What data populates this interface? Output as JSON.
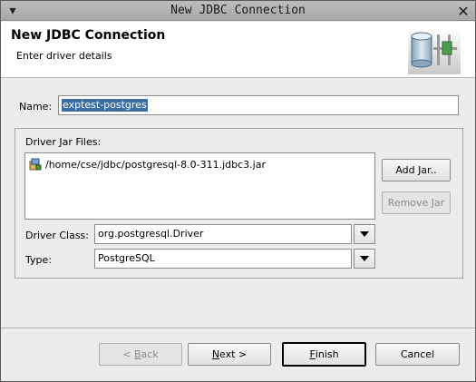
{
  "window": {
    "title": "New JDBC Connection"
  },
  "header": {
    "title": "New JDBC Connection",
    "subtitle": "Enter driver details",
    "icon": "database-connection-icon"
  },
  "name": {
    "label": "Name:",
    "value": "exptest-postgres"
  },
  "driver_jars": {
    "label": "Driver Jar Files:",
    "items": [
      {
        "path": "/home/cse/jdbc/postgresql-8.0-311.jdbc3.jar",
        "icon": "jar-file-icon"
      }
    ],
    "add_label": "Add Jar..",
    "remove_label": "Remove Jar"
  },
  "driver_class": {
    "label": "Driver Class:",
    "value": "org.postgresql.Driver"
  },
  "type": {
    "label": "Type:",
    "value": "PostgreSQL"
  },
  "buttons": {
    "back_prefix": "< ",
    "back_mnemonic": "B",
    "back_rest": "ack",
    "next_mnemonic": "N",
    "next_rest": "ext >",
    "finish_mnemonic": "F",
    "finish_rest": "inish",
    "cancel": "Cancel"
  }
}
